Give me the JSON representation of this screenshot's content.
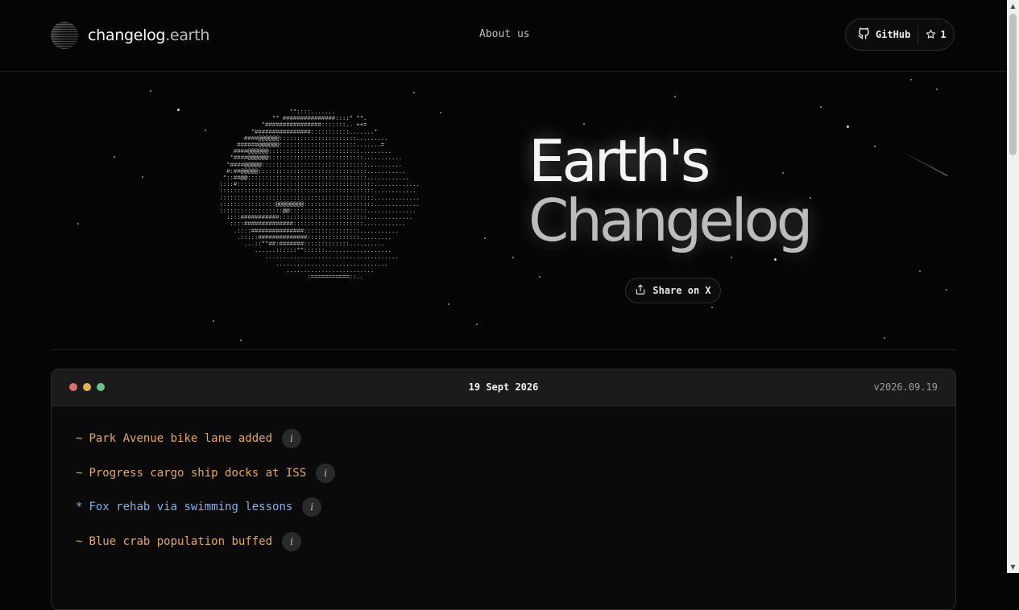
{
  "header": {
    "brand_main": "changelog",
    "brand_suffix": ".earth",
    "nav_about": "About us",
    "github_label": "GitHub",
    "star_count": "1"
  },
  "hero": {
    "title_line1": "Earth's",
    "title_line2": "Changelog",
    "share_label": "Share on X"
  },
  "changelog": {
    "date": "19 Sept 2026",
    "version": "v2026.09.19",
    "info_glyph": "i",
    "entries": [
      {
        "symbol": "~",
        "text": "Park Avenue bike lane added",
        "kind": "modified"
      },
      {
        "symbol": "~",
        "text": "Progress cargo ship docks at ISS",
        "kind": "modified"
      },
      {
        "symbol": "*",
        "text": "Fox rehab via swimming lessons",
        "kind": "added"
      },
      {
        "symbol": "~",
        "text": "Blue crab population buffed",
        "kind": "modified"
      }
    ]
  },
  "colors": {
    "modified": "#e4a75c",
    "added": "#7fb3e8",
    "background": "#050505"
  },
  "icons": [
    "globe-logo-icon",
    "github-icon",
    "star-icon",
    "share-icon",
    "info-icon"
  ]
}
